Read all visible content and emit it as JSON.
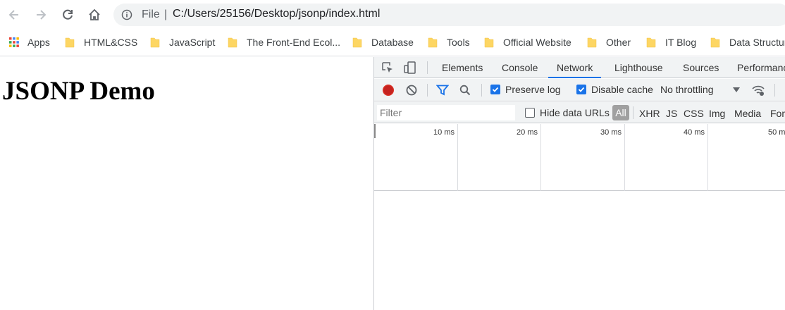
{
  "browser": {
    "omnibox": {
      "scheme": "File",
      "separator": "|",
      "url": "C:/Users/25156/Desktop/jsonp/index.html"
    },
    "bookmarks": [
      {
        "label": "Apps",
        "type": "apps"
      },
      {
        "label": "HTML&CSS",
        "type": "folder"
      },
      {
        "label": "JavaScript",
        "type": "folder"
      },
      {
        "label": "The Front-End Ecol...",
        "type": "folder"
      },
      {
        "label": "Database",
        "type": "folder"
      },
      {
        "label": "Tools",
        "type": "folder"
      },
      {
        "label": "Official Website",
        "type": "folder"
      },
      {
        "label": "Other",
        "type": "folder"
      },
      {
        "label": "IT Blog",
        "type": "folder"
      },
      {
        "label": "Data Structur",
        "type": "folder"
      }
    ],
    "icons": [
      "back-icon",
      "forward-icon",
      "reload-icon",
      "home-icon",
      "info-icon"
    ]
  },
  "page": {
    "heading": "JSONP Demo"
  },
  "devtools": {
    "tabs": [
      "Elements",
      "Console",
      "Network",
      "Lighthouse",
      "Sources",
      "Performanc"
    ],
    "active_tab": "Network",
    "toolbar": {
      "preserve_log": "Preserve log",
      "preserve_log_checked": true,
      "disable_cache": "Disable cache",
      "disable_cache_checked": true,
      "throttling": "No throttling"
    },
    "filterbar": {
      "placeholder": "Filter",
      "hide_data_urls": "Hide data URLs",
      "hide_data_urls_checked": false,
      "types": [
        "All",
        "XHR",
        "JS",
        "CSS",
        "Img",
        "Media",
        "Fon"
      ]
    },
    "timeline_ticks": [
      "10 ms",
      "20 ms",
      "30 ms",
      "40 ms",
      "50 m"
    ],
    "colors": {
      "accent": "#1a73e8",
      "record": "#d93025",
      "filter_icon": "#1a73e8"
    }
  }
}
